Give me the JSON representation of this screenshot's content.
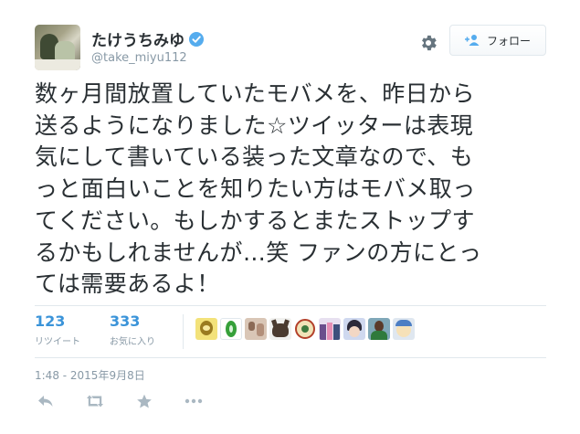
{
  "user": {
    "fullname": "たけうちみゆ",
    "screen_name": "@take_miyu112"
  },
  "follow_button": {
    "label": "フォロー"
  },
  "tweet": {
    "lines": [
      "数ヶ月間放置していたモバメを、昨日から",
      "送るようになりました☆ツイッターは表現",
      "気にして書いている装った文章なので、も",
      "っと面白いことを知りたい方はモバメ取っ",
      "てください。もしかするとまたストップす",
      "るかもしれませんが…笑 ファンの方にとっ",
      "ては需要あるよ！"
    ]
  },
  "stats": {
    "retweets": {
      "count": "123",
      "label": "リツイート"
    },
    "favorites": {
      "count": "333",
      "label": "お気に入り"
    }
  },
  "favoriters": [
    {
      "icon": "user-avatar-yellow"
    },
    {
      "icon": "user-avatar-green-leaf"
    },
    {
      "icon": "user-avatar-photo"
    },
    {
      "icon": "user-avatar-cat"
    },
    {
      "icon": "user-avatar-emblem"
    },
    {
      "icon": "user-avatar-group"
    },
    {
      "icon": "user-avatar-anime"
    },
    {
      "icon": "user-avatar-portrait"
    },
    {
      "icon": "user-avatar-character"
    }
  ],
  "timestamp": "1:48 - 2015年9月8日",
  "colors": {
    "link_blue": "#3b94d9",
    "muted_gray": "#8899a6",
    "text": "#292f33",
    "verified_blue": "#55acee"
  },
  "icons": {
    "verified": "verified-badge-icon",
    "gear": "gear-icon",
    "follow": "add-user-icon",
    "reply": "reply-icon",
    "retweet": "retweet-icon",
    "favorite": "star-icon",
    "more": "more-dots-icon"
  }
}
